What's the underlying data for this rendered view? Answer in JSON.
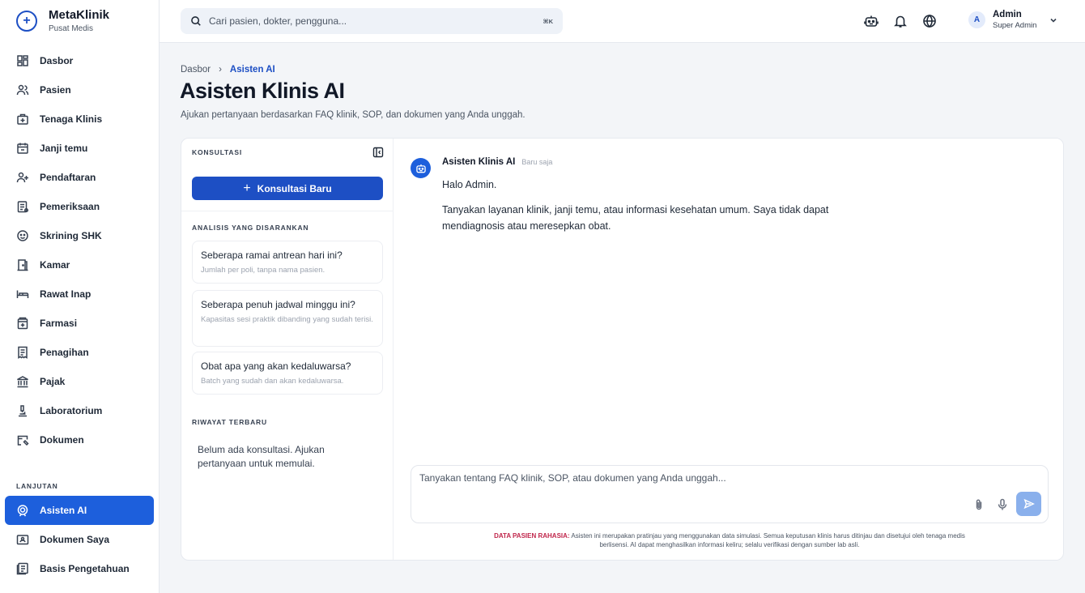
{
  "brand": {
    "name": "MetaKlinik",
    "subtitle": "Pusat Medis"
  },
  "nav": {
    "items": [
      {
        "label": "Dasbor",
        "icon": "dashboard-icon"
      },
      {
        "label": "Pasien",
        "icon": "patients-icon"
      },
      {
        "label": "Tenaga Klinis",
        "icon": "medical-bag-icon"
      },
      {
        "label": "Janji temu",
        "icon": "calendar-icon"
      },
      {
        "label": "Pendaftaran",
        "icon": "user-plus-icon"
      },
      {
        "label": "Pemeriksaan",
        "icon": "clipboard-icon"
      },
      {
        "label": "Skrining SHK",
        "icon": "screening-icon"
      },
      {
        "label": "Kamar",
        "icon": "room-icon"
      },
      {
        "label": "Rawat Inap",
        "icon": "bed-icon"
      },
      {
        "label": "Farmasi",
        "icon": "pharmacy-icon"
      },
      {
        "label": "Penagihan",
        "icon": "billing-icon"
      },
      {
        "label": "Pajak",
        "icon": "tax-icon"
      },
      {
        "label": "Laboratorium",
        "icon": "microscope-icon"
      },
      {
        "label": "Dokumen",
        "icon": "document-icon"
      }
    ],
    "section_label": "LANJUTAN",
    "advanced": [
      {
        "label": "Asisten AI",
        "icon": "ai-assistant-icon",
        "active": true
      },
      {
        "label": "Dokumen Saya",
        "icon": "my-documents-icon"
      },
      {
        "label": "Basis Pengetahuan",
        "icon": "knowledge-base-icon"
      }
    ]
  },
  "topbar": {
    "search_placeholder": "Cari pasien, dokter, pengguna...",
    "shortcut": "⌘K",
    "user": {
      "initial": "A",
      "name": "Admin",
      "role": "Super Admin"
    }
  },
  "header": {
    "breadcrumb_root": "Dasbor",
    "breadcrumb_sep": "›",
    "breadcrumb_current": "Asisten AI",
    "title": "Asisten Klinis AI",
    "subtitle": "Ajukan pertanyaan berdasarkan FAQ klinik, SOP, dan dokumen yang Anda unggah."
  },
  "left_panel": {
    "heading": "KONSULTASI",
    "new_button": "Konsultasi Baru",
    "suggested_heading": "ANALISIS YANG DISARANKAN",
    "suggestions": [
      {
        "title": "Seberapa ramai antrean hari ini?",
        "desc": "Jumlah per poli, tanpa nama pasien."
      },
      {
        "title": "Seberapa penuh jadwal minggu ini?",
        "desc": "Kapasitas sesi praktik dibanding yang sudah terisi."
      },
      {
        "title": "Obat apa yang akan kedaluwarsa?",
        "desc": "Batch yang sudah dan akan kedaluwarsa."
      }
    ],
    "history_heading": "RIWAYAT TERBARU",
    "history_empty": "Belum ada konsultasi. Ajukan pertanyaan untuk memulai."
  },
  "chat": {
    "assistant_name": "Asisten Klinis AI",
    "timestamp": "Baru saja",
    "greeting": "Halo Admin.",
    "message": "Tanyakan layanan klinik, janji temu, atau informasi kesehatan umum. Saya tidak dapat mendiagnosis atau meresepkan obat.",
    "input_placeholder": "Tanyakan tentang FAQ klinik, SOP, atau dokumen yang Anda unggah...",
    "disclaimer_label": "DATA PASIEN RAHASIA:",
    "disclaimer_text": "Asisten ini merupakan pratinjau yang menggunakan data simulasi. Semua keputusan klinis harus ditinjau dan disetujui oleh tenaga medis berlisensi. AI dapat menghasilkan informasi keliru; selalu verifikasi dengan sumber lab asli."
  },
  "colors": {
    "accent": "#1d4fc4",
    "active_nav": "#1d5fdc",
    "warning": "#c0264b",
    "send_disabled": "#8ab0ec"
  }
}
